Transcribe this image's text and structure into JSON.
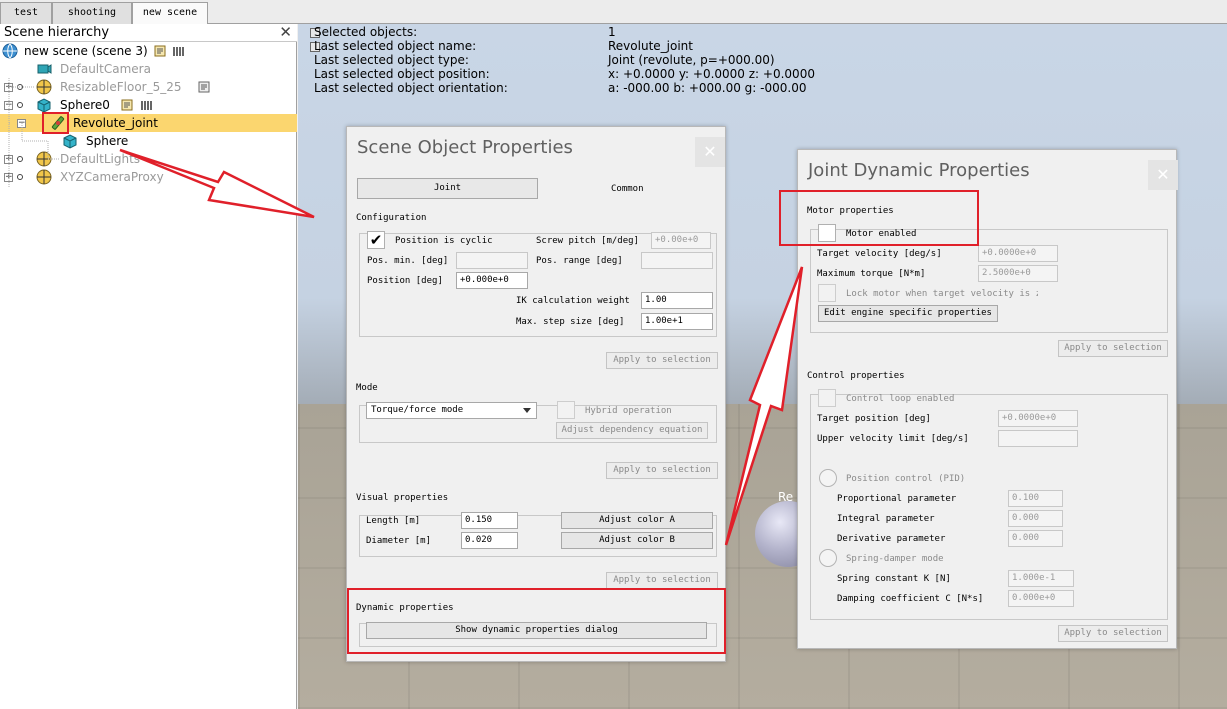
{
  "tabs": [
    {
      "label": "test"
    },
    {
      "label": "shooting"
    },
    {
      "label": "new scene",
      "active": true
    }
  ],
  "hierarchy": {
    "title": "Scene hierarchy",
    "close_glyph": "✕",
    "root_label": "new scene (scene 3)",
    "items": [
      {
        "label": "DefaultCamera",
        "muted": true
      },
      {
        "label": "ResizableFloor_5_25",
        "muted": true
      },
      {
        "label": "Sphere0",
        "muted": false
      },
      {
        "label": "Revolute_joint",
        "muted": false,
        "selected": true
      },
      {
        "label": "Sphere",
        "muted": false
      },
      {
        "label": "DefaultLights",
        "muted": true
      },
      {
        "label": "XYZCameraProxy",
        "muted": true
      }
    ]
  },
  "scene_info": {
    "rows": [
      {
        "key": "Selected objects:",
        "value": "1"
      },
      {
        "key": "Last selected object name:",
        "value": "Revolute_joint"
      },
      {
        "key": "Last selected object type:",
        "value": "Joint (revolute, p=+000.00)"
      },
      {
        "key": "Last selected object position:",
        "value": "x: +0.0000   y: +0.0000   z: +0.0000"
      },
      {
        "key": "Last selected object orientation:",
        "value": "a: -000.00   b: +000.00   g: -000.00"
      }
    ],
    "scene_label_fragment": "Re"
  },
  "scene_object_properties": {
    "title": "Scene Object Properties",
    "close_glyph": "✕",
    "tab_joint": "Joint",
    "tab_common": "Common",
    "configuration": {
      "heading": "Configuration",
      "position_cyclic_label": "Position is cyclic",
      "position_cyclic_checked": true,
      "check_glyph": "✔",
      "screw_pitch_label": "Screw pitch [m/deg]",
      "screw_pitch_value": "+0.00e+0",
      "pos_min_label": "Pos. min. [deg]",
      "pos_min_value": "",
      "pos_range_label": "Pos. range [deg]",
      "pos_range_value": "",
      "position_label": "Position [deg]",
      "position_value": "+0.000e+0",
      "ik_weight_label": "IK calculation weight",
      "ik_weight_value": "1.00",
      "max_step_label": "Max. step size [deg]",
      "max_step_value": "1.00e+1",
      "apply_label": "Apply to selection"
    },
    "mode": {
      "heading": "Mode",
      "selected": "Torque/force mode",
      "hybrid_label": "Hybrid operation",
      "adjust_dependency_label": "Adjust dependency equation",
      "apply_label": "Apply to selection"
    },
    "visual": {
      "heading": "Visual properties",
      "length_label": "Length [m]",
      "length_value": "0.150",
      "diameter_label": "Diameter [m]",
      "diameter_value": "0.020",
      "color_a_label": "Adjust color A",
      "color_b_label": "Adjust color B",
      "apply_label": "Apply to selection"
    },
    "dynamic": {
      "heading": "Dynamic properties",
      "show_dialog_label": "Show dynamic properties dialog"
    }
  },
  "joint_dynamic_properties": {
    "title": "Joint Dynamic Properties",
    "close_glyph": "✕",
    "motor": {
      "heading": "Motor properties",
      "motor_enabled_label": "Motor enabled",
      "target_velocity_label": "Target velocity [deg/s]",
      "target_velocity_value": "+0.0000e+0",
      "max_torque_label": "Maximum torque [N*m]",
      "max_torque_value": "2.5000e+0",
      "lock_motor_label": "Lock motor when target velocity is zero",
      "edit_engine_label": "Edit engine specific properties",
      "apply_label": "Apply to selection"
    },
    "control": {
      "heading": "Control properties",
      "loop_enabled_label": "Control loop enabled",
      "target_position_label": "Target position [deg]",
      "target_position_value": "+0.0000e+0",
      "upper_velocity_label": "Upper velocity limit [deg/s]",
      "upper_velocity_value": "",
      "position_control_label": "Position control (PID)",
      "proportional_label": "Proportional parameter",
      "proportional_value": "0.100",
      "integral_label": "Integral parameter",
      "integral_value": "0.000",
      "derivative_label": "Derivative parameter",
      "derivative_value": "0.000",
      "spring_damper_label": "Spring-damper mode",
      "spring_k_label": "Spring constant K [N]",
      "spring_k_value": "1.000e-1",
      "damping_c_label": "Damping coefficient C [N*s]",
      "damping_c_value": "0.000e+0",
      "apply_label": "Apply to selection"
    }
  },
  "colors": {
    "selection_highlight": "#fbd66f",
    "annotation_red": "#e0202a"
  }
}
